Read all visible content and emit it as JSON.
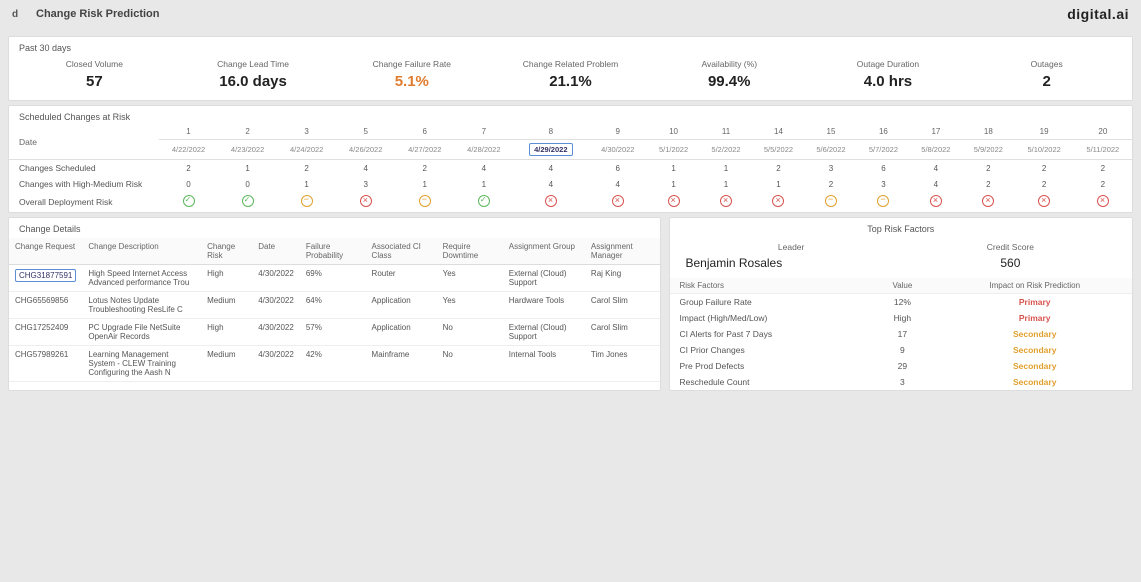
{
  "header": {
    "app_badge": "d",
    "title": "Change Risk Prediction",
    "brand": "digital.ai"
  },
  "kpi_panel": {
    "title": "Past 30 days",
    "items": [
      {
        "label": "Closed Volume",
        "value": "57"
      },
      {
        "label": "Change Lead Time",
        "value": "16.0 days"
      },
      {
        "label": "Change Failure Rate",
        "value": "5.1%",
        "accent": "orange"
      },
      {
        "label": "Change Related Problem",
        "value": "21.1%"
      },
      {
        "label": "Availability (%)",
        "value": "99.4%"
      },
      {
        "label": "Outage Duration",
        "value": "4.0 hrs"
      },
      {
        "label": "Outages",
        "value": "2"
      }
    ]
  },
  "scheduled": {
    "title": "Scheduled Changes at Risk",
    "date_label": "Date",
    "columns": [
      {
        "n": "1",
        "d": "4/22/2022"
      },
      {
        "n": "2",
        "d": "4/23/2022"
      },
      {
        "n": "3",
        "d": "4/24/2022"
      },
      {
        "n": "5",
        "d": "4/26/2022"
      },
      {
        "n": "6",
        "d": "4/27/2022"
      },
      {
        "n": "7",
        "d": "4/28/2022"
      },
      {
        "n": "8",
        "d": "4/29/2022",
        "selected": true
      },
      {
        "n": "9",
        "d": "4/30/2022"
      },
      {
        "n": "10",
        "d": "5/1/2022"
      },
      {
        "n": "11",
        "d": "5/2/2022"
      },
      {
        "n": "14",
        "d": "5/5/2022"
      },
      {
        "n": "15",
        "d": "5/6/2022"
      },
      {
        "n": "16",
        "d": "5/7/2022"
      },
      {
        "n": "17",
        "d": "5/8/2022"
      },
      {
        "n": "18",
        "d": "5/9/2022"
      },
      {
        "n": "19",
        "d": "5/10/2022"
      },
      {
        "n": "20",
        "d": "5/11/2022"
      }
    ],
    "rows": [
      {
        "label": "Changes Scheduled",
        "vals": [
          "2",
          "1",
          "2",
          "4",
          "2",
          "4",
          "4",
          "6",
          "1",
          "1",
          "2",
          "3",
          "6",
          "4",
          "2",
          "2",
          "2"
        ]
      },
      {
        "label": "Changes with High-Medium Risk",
        "vals": [
          "0",
          "0",
          "1",
          "3",
          "1",
          "1",
          "4",
          "4",
          "1",
          "1",
          "1",
          "2",
          "3",
          "4",
          "2",
          "2",
          "2"
        ]
      },
      {
        "label": "Overall Deployment Risk",
        "risk": [
          "green",
          "green",
          "orange",
          "red",
          "orange",
          "green",
          "red",
          "red",
          "red",
          "red",
          "red",
          "orange",
          "orange",
          "red",
          "red",
          "red",
          "red"
        ]
      }
    ]
  },
  "details": {
    "title": "Change Details",
    "headers": [
      "Change Request",
      "Change Description",
      "Change Risk",
      "Date",
      "Failure Probability",
      "Associated CI Class",
      "Require Downtime",
      "Assignment Group",
      "Assignment Manager"
    ],
    "rows": [
      {
        "req": "CHG31877591",
        "selected": true,
        "desc": "High Speed Internet Access Advanced performance Trou",
        "risk": "High",
        "date": "4/30/2022",
        "prob": "69%",
        "ci": "Router",
        "dt": "Yes",
        "group": "External (Cloud) Support",
        "mgr": "Raj King"
      },
      {
        "req": "CHG65569856",
        "desc": "Lotus Notes Update Troubleshooting ResLife C",
        "risk": "Medium",
        "date": "4/30/2022",
        "prob": "64%",
        "ci": "Application",
        "dt": "Yes",
        "group": "Hardware Tools",
        "mgr": "Carol Slim"
      },
      {
        "req": "CHG17252409",
        "desc": "PC Upgrade File NetSuite OpenAir Records",
        "risk": "High",
        "date": "4/30/2022",
        "prob": "57%",
        "ci": "Application",
        "dt": "No",
        "group": "External (Cloud) Support",
        "mgr": "Carol Slim"
      },
      {
        "req": "CHG57989261",
        "desc": "Learning Management System - CLEW Training Configuring the Aash N",
        "risk": "Medium",
        "date": "4/30/2022",
        "prob": "42%",
        "ci": "Mainframe",
        "dt": "No",
        "group": "Internal Tools",
        "mgr": "Tim Jones"
      }
    ]
  },
  "risk_factors": {
    "title": "Top Risk Factors",
    "leader_label": "Leader",
    "leader_value": "Benjamin Rosales",
    "score_label": "Credit Score",
    "score_value": "560",
    "headers": [
      "Risk Factors",
      "Value",
      "Impact on Risk Prediction"
    ],
    "rows": [
      {
        "f": "Group Failure Rate",
        "v": "12%",
        "impact": "Primary"
      },
      {
        "f": "Impact (High/Med/Low)",
        "v": "High",
        "impact": "Primary"
      },
      {
        "f": "CI Alerts for Past 7 Days",
        "v": "17",
        "impact": "Secondary"
      },
      {
        "f": "CI Prior Changes",
        "v": "9",
        "impact": "Secondary"
      },
      {
        "f": "Pre Prod Defects",
        "v": "29",
        "impact": "Secondary"
      },
      {
        "f": "Reschedule Count",
        "v": "3",
        "impact": "Secondary"
      }
    ]
  }
}
